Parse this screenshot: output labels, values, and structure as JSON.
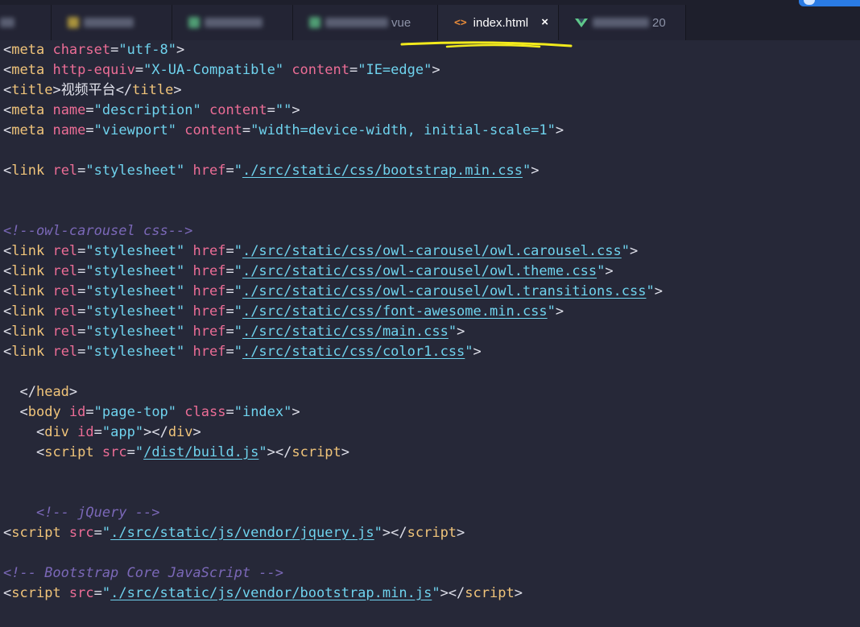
{
  "tabs": [
    {
      "label": "",
      "blurred": true
    },
    {
      "label": "",
      "blurred": true,
      "icon_color": "#d6b840"
    },
    {
      "label": "",
      "blurred": true,
      "icon_color": "#5fc78a"
    },
    {
      "label": "",
      "blurred": true,
      "icon_color": "#5fc78a",
      "visible_suffix": "vue"
    },
    {
      "label": "index.html",
      "active": true,
      "icon": "code-icon",
      "close": "×"
    },
    {
      "label": "",
      "blurred": true,
      "icon": "vue-icon",
      "visible_suffix": "20"
    }
  ],
  "code_lines": [
    [
      [
        "bracket",
        "<"
      ],
      [
        "tag",
        "meta"
      ],
      [
        "plain",
        " "
      ],
      [
        "attr",
        "charset"
      ],
      [
        "eq",
        "="
      ],
      [
        "str",
        "\"utf-8\""
      ],
      [
        "bracket",
        ">"
      ]
    ],
    [
      [
        "bracket",
        "<"
      ],
      [
        "tag",
        "meta"
      ],
      [
        "plain",
        " "
      ],
      [
        "attr",
        "http-equiv"
      ],
      [
        "eq",
        "="
      ],
      [
        "str",
        "\"X-UA-Compatible\""
      ],
      [
        "plain",
        " "
      ],
      [
        "attr",
        "content"
      ],
      [
        "eq",
        "="
      ],
      [
        "str",
        "\"IE=edge\""
      ],
      [
        "bracket",
        ">"
      ]
    ],
    [
      [
        "bracket",
        "<"
      ],
      [
        "tag",
        "title"
      ],
      [
        "bracket",
        ">"
      ],
      [
        "text",
        "视频平台"
      ],
      [
        "bracket",
        "</"
      ],
      [
        "tag",
        "title"
      ],
      [
        "bracket",
        ">"
      ]
    ],
    [
      [
        "bracket",
        "<"
      ],
      [
        "tag",
        "meta"
      ],
      [
        "plain",
        " "
      ],
      [
        "attr",
        "name"
      ],
      [
        "eq",
        "="
      ],
      [
        "str",
        "\"description\""
      ],
      [
        "plain",
        " "
      ],
      [
        "attr",
        "content"
      ],
      [
        "eq",
        "="
      ],
      [
        "str",
        "\"\""
      ],
      [
        "bracket",
        ">"
      ]
    ],
    [
      [
        "bracket",
        "<"
      ],
      [
        "tag",
        "meta"
      ],
      [
        "plain",
        " "
      ],
      [
        "attr",
        "name"
      ],
      [
        "eq",
        "="
      ],
      [
        "str",
        "\"viewport\""
      ],
      [
        "plain",
        " "
      ],
      [
        "attr",
        "content"
      ],
      [
        "eq",
        "="
      ],
      [
        "str",
        "\"width=device-width, initial-scale=1\""
      ],
      [
        "bracket",
        ">"
      ]
    ],
    [],
    [
      [
        "bracket",
        "<"
      ],
      [
        "tag",
        "link"
      ],
      [
        "plain",
        " "
      ],
      [
        "attr",
        "rel"
      ],
      [
        "eq",
        "="
      ],
      [
        "str",
        "\"stylesheet\""
      ],
      [
        "plain",
        " "
      ],
      [
        "attr",
        "href"
      ],
      [
        "eq",
        "="
      ],
      [
        "str",
        "\""
      ],
      [
        "link",
        "./src/static/css/bootstrap.min.css"
      ],
      [
        "str",
        "\""
      ],
      [
        "bracket",
        ">"
      ]
    ],
    [],
    [],
    [
      [
        "comment",
        "<!--owl-carousel css-->"
      ]
    ],
    [
      [
        "bracket",
        "<"
      ],
      [
        "tag",
        "link"
      ],
      [
        "plain",
        " "
      ],
      [
        "attr",
        "rel"
      ],
      [
        "eq",
        "="
      ],
      [
        "str",
        "\"stylesheet\""
      ],
      [
        "plain",
        " "
      ],
      [
        "attr",
        "href"
      ],
      [
        "eq",
        "="
      ],
      [
        "str",
        "\""
      ],
      [
        "link",
        "./src/static/css/owl-carousel/owl.carousel.css"
      ],
      [
        "str",
        "\""
      ],
      [
        "bracket",
        ">"
      ]
    ],
    [
      [
        "bracket",
        "<"
      ],
      [
        "tag",
        "link"
      ],
      [
        "plain",
        " "
      ],
      [
        "attr",
        "rel"
      ],
      [
        "eq",
        "="
      ],
      [
        "str",
        "\"stylesheet\""
      ],
      [
        "plain",
        " "
      ],
      [
        "attr",
        "href"
      ],
      [
        "eq",
        "="
      ],
      [
        "str",
        "\""
      ],
      [
        "link",
        "./src/static/css/owl-carousel/owl.theme.css"
      ],
      [
        "str",
        "\""
      ],
      [
        "bracket",
        ">"
      ]
    ],
    [
      [
        "bracket",
        "<"
      ],
      [
        "tag",
        "link"
      ],
      [
        "plain",
        " "
      ],
      [
        "attr",
        "rel"
      ],
      [
        "eq",
        "="
      ],
      [
        "str",
        "\"stylesheet\""
      ],
      [
        "plain",
        " "
      ],
      [
        "attr",
        "href"
      ],
      [
        "eq",
        "="
      ],
      [
        "str",
        "\""
      ],
      [
        "link",
        "./src/static/css/owl-carousel/owl.transitions.css"
      ],
      [
        "str",
        "\""
      ],
      [
        "bracket",
        ">"
      ]
    ],
    [
      [
        "bracket",
        "<"
      ],
      [
        "tag",
        "link"
      ],
      [
        "plain",
        " "
      ],
      [
        "attr",
        "rel"
      ],
      [
        "eq",
        "="
      ],
      [
        "str",
        "\"stylesheet\""
      ],
      [
        "plain",
        " "
      ],
      [
        "attr",
        "href"
      ],
      [
        "eq",
        "="
      ],
      [
        "str",
        "\""
      ],
      [
        "link",
        "./src/static/css/font-awesome.min.css"
      ],
      [
        "str",
        "\""
      ],
      [
        "bracket",
        ">"
      ]
    ],
    [
      [
        "bracket",
        "<"
      ],
      [
        "tag",
        "link"
      ],
      [
        "plain",
        " "
      ],
      [
        "attr",
        "rel"
      ],
      [
        "eq",
        "="
      ],
      [
        "str",
        "\"stylesheet\""
      ],
      [
        "plain",
        " "
      ],
      [
        "attr",
        "href"
      ],
      [
        "eq",
        "="
      ],
      [
        "str",
        "\""
      ],
      [
        "link",
        "./src/static/css/main.css"
      ],
      [
        "str",
        "\""
      ],
      [
        "bracket",
        ">"
      ]
    ],
    [
      [
        "bracket",
        "<"
      ],
      [
        "tag",
        "link"
      ],
      [
        "plain",
        " "
      ],
      [
        "attr",
        "rel"
      ],
      [
        "eq",
        "="
      ],
      [
        "str",
        "\"stylesheet\""
      ],
      [
        "plain",
        " "
      ],
      [
        "attr",
        "href"
      ],
      [
        "eq",
        "="
      ],
      [
        "str",
        "\""
      ],
      [
        "link",
        "./src/static/css/color1.css"
      ],
      [
        "str",
        "\""
      ],
      [
        "bracket",
        ">"
      ]
    ],
    [],
    [
      [
        "plain",
        "  "
      ],
      [
        "bracket",
        "</"
      ],
      [
        "tag",
        "head"
      ],
      [
        "bracket",
        ">"
      ]
    ],
    [
      [
        "plain",
        "  "
      ],
      [
        "bracket",
        "<"
      ],
      [
        "tag",
        "body"
      ],
      [
        "plain",
        " "
      ],
      [
        "attr",
        "id"
      ],
      [
        "eq",
        "="
      ],
      [
        "str",
        "\"page-top\""
      ],
      [
        "plain",
        " "
      ],
      [
        "attr",
        "class"
      ],
      [
        "eq",
        "="
      ],
      [
        "str",
        "\"index\""
      ],
      [
        "bracket",
        ">"
      ]
    ],
    [
      [
        "plain",
        "    "
      ],
      [
        "bracket",
        "<"
      ],
      [
        "tag",
        "div"
      ],
      [
        "plain",
        " "
      ],
      [
        "attr",
        "id"
      ],
      [
        "eq",
        "="
      ],
      [
        "str",
        "\"app\""
      ],
      [
        "bracket",
        "></"
      ],
      [
        "tag",
        "div"
      ],
      [
        "bracket",
        ">"
      ]
    ],
    [
      [
        "plain",
        "    "
      ],
      [
        "bracket",
        "<"
      ],
      [
        "tag",
        "script"
      ],
      [
        "plain",
        " "
      ],
      [
        "attr",
        "src"
      ],
      [
        "eq",
        "="
      ],
      [
        "str",
        "\""
      ],
      [
        "link",
        "/dist/build.js"
      ],
      [
        "str",
        "\""
      ],
      [
        "bracket",
        "></"
      ],
      [
        "tag",
        "script"
      ],
      [
        "bracket",
        ">"
      ]
    ],
    [],
    [],
    [
      [
        "plain",
        "    "
      ],
      [
        "comment",
        "<!-- jQuery -->"
      ]
    ],
    [
      [
        "bracket",
        "<"
      ],
      [
        "tag",
        "script"
      ],
      [
        "plain",
        " "
      ],
      [
        "attr",
        "src"
      ],
      [
        "eq",
        "="
      ],
      [
        "str",
        "\""
      ],
      [
        "link",
        "./src/static/js/vendor/jquery.js"
      ],
      [
        "str",
        "\""
      ],
      [
        "bracket",
        "></"
      ],
      [
        "tag",
        "script"
      ],
      [
        "bracket",
        ">"
      ]
    ],
    [],
    [
      [
        "comment",
        "<!-- Bootstrap Core JavaScript -->"
      ]
    ],
    [
      [
        "bracket",
        "<"
      ],
      [
        "tag",
        "script"
      ],
      [
        "plain",
        " "
      ],
      [
        "attr",
        "src"
      ],
      [
        "eq",
        "="
      ],
      [
        "str",
        "\""
      ],
      [
        "link",
        "./src/static/js/vendor/bootstrap.min.js"
      ],
      [
        "str",
        "\""
      ],
      [
        "bracket",
        "></"
      ],
      [
        "tag",
        "script"
      ],
      [
        "bracket",
        ">"
      ]
    ]
  ]
}
